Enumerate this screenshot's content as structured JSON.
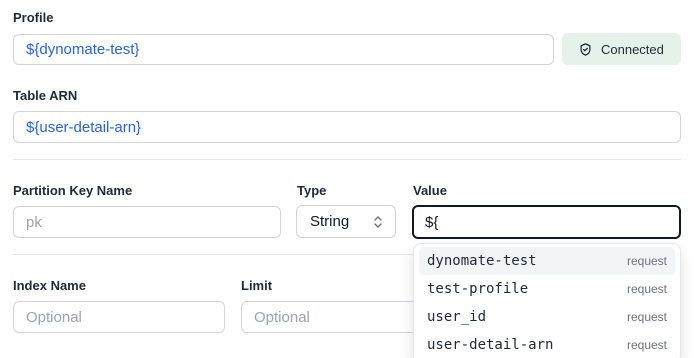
{
  "profile": {
    "label": "Profile",
    "value": "${dynomate-test}",
    "status": "Connected",
    "status_icon": "shield-check-icon"
  },
  "table_arn": {
    "label": "Table ARN",
    "value": "${user-detail-arn}"
  },
  "partition_key": {
    "name_label": "Partition Key Name",
    "name_placeholder": "pk",
    "type_label": "Type",
    "type_value": "String",
    "value_label": "Value",
    "value_input": "${"
  },
  "autocomplete": [
    {
      "name": "dynomate-test",
      "kind": "request"
    },
    {
      "name": "test-profile",
      "kind": "request"
    },
    {
      "name": "user_id",
      "kind": "request"
    },
    {
      "name": "user-detail-arn",
      "kind": "request"
    }
  ],
  "index": {
    "label": "Index Name",
    "placeholder": "Optional"
  },
  "limit": {
    "label": "Limit",
    "placeholder": "Optional"
  },
  "colors": {
    "variable_text": "#2563eb",
    "connected_bg": "#e5f2ea"
  }
}
